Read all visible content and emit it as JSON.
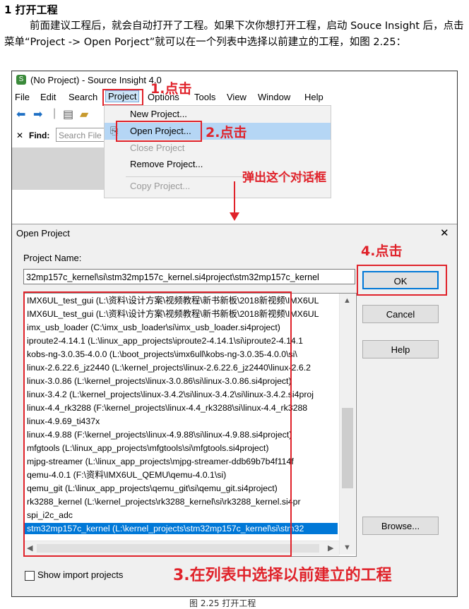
{
  "doc": {
    "heading": "1 打开工程",
    "paragraph": "前面建议工程后，就会自动打开了工程。如果下次你想打开工程，启动 Souce Insight 后，点击菜单“Project -> Open Porject”就可以在一个列表中选择以前建立的工程，如图 2.25：",
    "caption": "图 2.25 打开工程"
  },
  "app": {
    "title": "(No Project) - Source Insight 4.0",
    "menu": [
      "File",
      "Edit",
      "Search",
      "Project",
      "Options",
      "Tools",
      "View",
      "Window",
      "Help"
    ],
    "find_label": "Find:",
    "find_placeholder": "Search File",
    "project_menu": [
      "New Project...",
      "Open Project...",
      "Close Project",
      "Remove Project...",
      "Copy Project..."
    ]
  },
  "annotations": {
    "step1": "1.点击",
    "step2": "2.点击",
    "popup": "弹出这个对话框",
    "step3": "3.在列表中选择以前建立的工程",
    "step4": "4.点击"
  },
  "dialog": {
    "title": "Open Project",
    "close": "✕",
    "project_name_label": "Project Name:",
    "project_name_value": "32mp157c_kernel\\si\\stm32mp157c_kernel.si4project\\stm32mp157c_kernel",
    "projects": [
      "IMX6UL_test_gui (L:\\资料\\设计方案\\视频教程\\新书新板\\2018新视频\\IMX6UL",
      "IMX6UL_test_gui (L:\\资料\\设计方案\\视频教程\\新书新板\\2018新视频\\IMX6UL",
      "imx_usb_loader (C:\\imx_usb_loader\\si\\imx_usb_loader.si4project)",
      "iproute2-4.14.1 (L:\\linux_app_projects\\iproute2-4.14.1\\si\\iproute2-4.14.1",
      "kobs-ng-3.0.35-4.0.0 (L:\\boot_projects\\imx6ull\\kobs-ng-3.0.35-4.0.0\\si\\",
      "linux-2.6.22.6_jz2440 (L:\\kernel_projects\\linux-2.6.22.6_jz2440\\linux-2.6.2",
      "linux-3.0.86 (L:\\kernel_projects\\linux-3.0.86\\si\\linux-3.0.86.si4project)",
      "linux-3.4.2 (L:\\kernel_projects\\linux-3.4.2\\si\\linux-3.4.2\\si\\linux-3.4.2.si4proj",
      "linux-4.4_rk3288 (F:\\kernel_projects\\linux-4.4_rk3288\\si\\linux-4.4_rk3288",
      "linux-4.9.69_ti437x",
      "linux-4.9.88 (F:\\kernel_projects\\linux-4.9.88\\si\\linux-4.9.88.si4project)",
      "mfgtools (L:\\linux_app_projects\\mfgtools\\si\\mfgtools.si4project)",
      "mjpg-streamer (L:\\linux_app_projects\\mjpg-streamer-ddb69b7b4f114f",
      "qemu-4.0.1 (F:\\资料\\IMX6UL_QEMU\\qemu-4.0.1\\si)",
      "qemu_git (L:\\linux_app_projects\\qemu_git\\si\\qemu_git.si4project)",
      "rk3288_kernel (L:\\kernel_projects\\rk3288_kernel\\si\\rk3288_kernel.si4pr",
      "spi_i2c_adc",
      "stm32mp157c_kernel (L:\\kernel_projects\\stm32mp157c_kernel\\si\\stm32"
    ],
    "selected_index": 17,
    "ok": "OK",
    "cancel": "Cancel",
    "help": "Help",
    "browse": "Browse...",
    "show_import": "Show import projects"
  },
  "colors": {
    "annotation_red": "#e0222a",
    "selection_blue": "#0078d7"
  }
}
